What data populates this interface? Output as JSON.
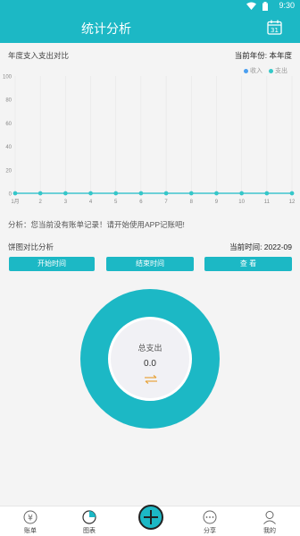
{
  "statusbar": {
    "time": "9:30"
  },
  "header": {
    "title": "统计分析",
    "calendar_day": "31"
  },
  "annual": {
    "title": "年度支入支出对比",
    "year_label": "当前年份: 本年度"
  },
  "legend": [
    {
      "name": "收入",
      "color": "#4a9ff0"
    },
    {
      "name": "支出",
      "color": "#35c8c8"
    }
  ],
  "chart_data": {
    "type": "line",
    "categories": [
      "1月",
      "2",
      "3",
      "4",
      "5",
      "6",
      "7",
      "8",
      "9",
      "10",
      "11",
      "12"
    ],
    "y_ticks": [
      "100",
      "80",
      "60",
      "40",
      "20",
      "0"
    ],
    "ylim": [
      0,
      100
    ],
    "series": [
      {
        "name": "收入",
        "values": [
          0,
          0,
          0,
          0,
          0,
          0,
          0,
          0,
          0,
          0,
          0,
          0
        ],
        "color": "#4a9ff0"
      },
      {
        "name": "支出",
        "values": [
          0,
          0,
          0,
          0,
          0,
          0,
          0,
          0,
          0,
          0,
          0,
          0
        ],
        "color": "#35c8c8"
      }
    ],
    "grid": true
  },
  "analysis": "分析：您当前没有账单记录！请开始使用APP记账吧!",
  "pie": {
    "title": "饼图对比分析",
    "time_label": "当前时间: 2022-09",
    "buttons": {
      "start": "开始时间",
      "end": "结束时间",
      "view": "查 看"
    },
    "center_label": "总支出",
    "center_value": "0.0"
  },
  "nav": {
    "bill": "账单",
    "chart": "图表",
    "share": "分享",
    "mine": "我的"
  }
}
